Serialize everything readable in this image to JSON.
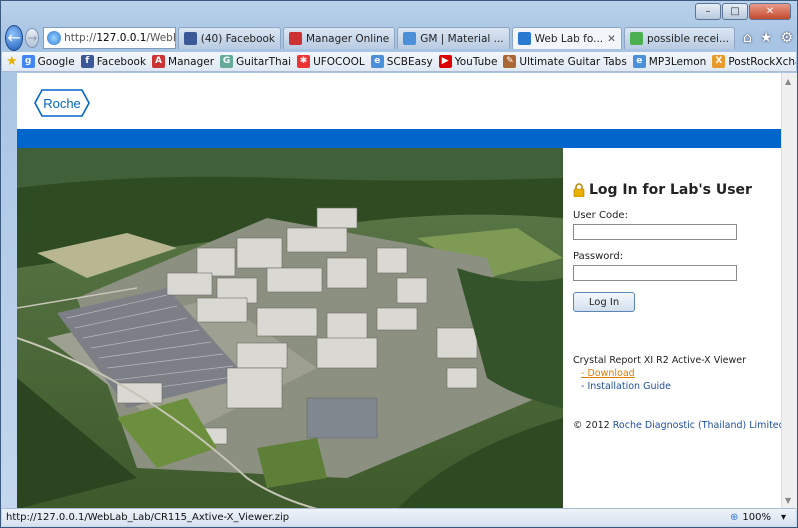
{
  "browser": {
    "address": {
      "prefix": "http://",
      "host": "127.0.0.1",
      "path": "/WebLab_I",
      "tools": "⌕ ▾ ⊡ ↻ ✕"
    },
    "tabs": [
      {
        "label": "(40) Facebook",
        "color": "#3b5998"
      },
      {
        "label": "Manager Online",
        "color": "#c33"
      },
      {
        "label": "GM | Material ...",
        "color": "#4a8fd8"
      },
      {
        "label": "Web Lab fo...",
        "color": "#2a7ad1",
        "close": "✕"
      },
      {
        "label": "possible recei...",
        "color": "#4caf50"
      }
    ],
    "nav_icons": [
      "⌂",
      "★",
      "⚙"
    ],
    "favorites": [
      {
        "label": "Google",
        "color": "#4285f4",
        "glyph": "g"
      },
      {
        "label": "Facebook",
        "color": "#3b5998",
        "glyph": "f"
      },
      {
        "label": "Manager",
        "color": "#c33",
        "glyph": "A"
      },
      {
        "label": "GuitarThai",
        "color": "#6a9",
        "glyph": "G"
      },
      {
        "label": "UFOCOOL",
        "color": "#e33",
        "glyph": "✱"
      },
      {
        "label": "SCBEasy",
        "color": "#4a8fd8",
        "glyph": "e"
      },
      {
        "label": "YouTube",
        "color": "#d00",
        "glyph": "▶"
      },
      {
        "label": "Ultimate Guitar Tabs",
        "color": "#a63",
        "glyph": "✎"
      },
      {
        "label": "MP3Lemon",
        "color": "#4a8fd8",
        "glyph": "e"
      },
      {
        "label": "PostRockXchange",
        "color": "#e89a2b",
        "glyph": "X"
      }
    ]
  },
  "page": {
    "logo_text": "Roche",
    "login": {
      "title": "Log In for Lab's User",
      "user_code_label": "User Code:",
      "password_label": "Password:",
      "button": "Log In",
      "crystal_text": "Crystal Report XI R2 Active-X Viewer",
      "download": "- Download",
      "guide": "- Installation Guide",
      "copyright": "© 2012",
      "company": "Roche Diagnostic (Thailand) Limited"
    }
  },
  "status": {
    "url": "http://127.0.0.1/WebLab_Lab/CR115_Axtive-X_Viewer.zip",
    "zoom": "100%"
  },
  "colors": {
    "brand_blue": "#0066cc",
    "link_orange": "#e07b00"
  }
}
